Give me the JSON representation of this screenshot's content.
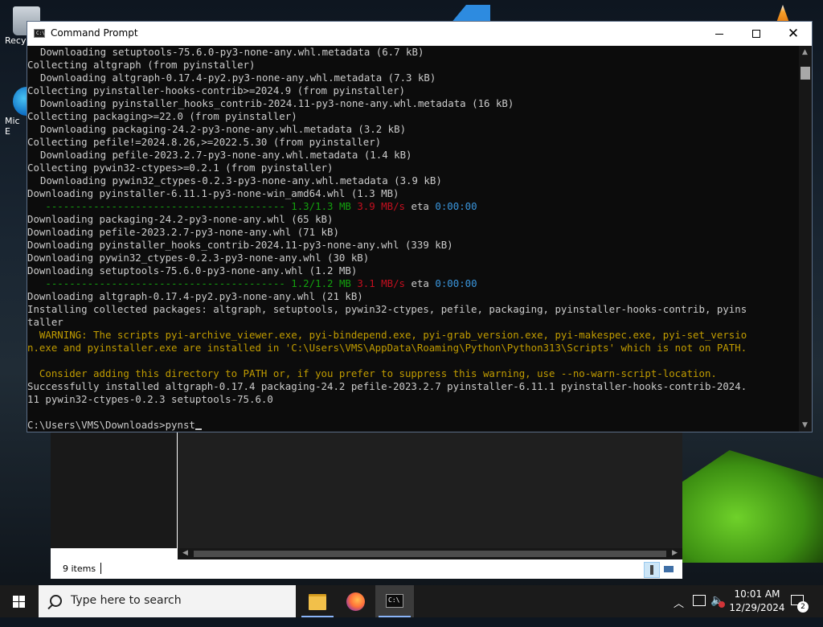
{
  "desktop": {
    "icons": [
      {
        "label": "Recy",
        "icon": "recycle-bin-icon"
      },
      {
        "label": "Mic\nE",
        "icon": "edge-icon"
      }
    ]
  },
  "cmd_window": {
    "title": "Command Prompt",
    "controls": {
      "minimize": "minimize",
      "maximize": "maximize",
      "close": "✕"
    },
    "lines": [
      {
        "type": "indent",
        "text": "Downloading setuptools-75.6.0-py3-none-any.whl.metadata (6.7 kB)"
      },
      {
        "type": "plain",
        "text": "Collecting altgraph (from pyinstaller)"
      },
      {
        "type": "indent",
        "text": "Downloading altgraph-0.17.4-py2.py3-none-any.whl.metadata (7.3 kB)"
      },
      {
        "type": "plain",
        "text": "Collecting pyinstaller-hooks-contrib>=2024.9 (from pyinstaller)"
      },
      {
        "type": "indent",
        "text": "Downloading pyinstaller_hooks_contrib-2024.11-py3-none-any.whl.metadata (16 kB)"
      },
      {
        "type": "plain",
        "text": "Collecting packaging>=22.0 (from pyinstaller)"
      },
      {
        "type": "indent",
        "text": "Downloading packaging-24.2-py3-none-any.whl.metadata (3.2 kB)"
      },
      {
        "type": "plain",
        "text": "Collecting pefile!=2024.8.26,>=2022.5.30 (from pyinstaller)"
      },
      {
        "type": "indent",
        "text": "Downloading pefile-2023.2.7-py3-none-any.whl.metadata (1.4 kB)"
      },
      {
        "type": "plain",
        "text": "Collecting pywin32-ctypes>=0.2.1 (from pyinstaller)"
      },
      {
        "type": "indent",
        "text": "Downloading pywin32_ctypes-0.2.3-py3-none-any.whl.metadata (3.9 kB)"
      },
      {
        "type": "plain",
        "text": "Downloading pyinstaller-6.11.1-py3-none-win_amd64.whl (1.3 MB)"
      },
      {
        "type": "progress",
        "bar": "----------------------------------------",
        "size": "1.3/1.3 MB",
        "speed": "3.9 MB/s",
        "eta_label": "eta",
        "eta": "0:00:00"
      },
      {
        "type": "plain",
        "text": "Downloading packaging-24.2-py3-none-any.whl (65 kB)"
      },
      {
        "type": "plain",
        "text": "Downloading pefile-2023.2.7-py3-none-any.whl (71 kB)"
      },
      {
        "type": "plain",
        "text": "Downloading pyinstaller_hooks_contrib-2024.11-py3-none-any.whl (339 kB)"
      },
      {
        "type": "plain",
        "text": "Downloading pywin32_ctypes-0.2.3-py3-none-any.whl (30 kB)"
      },
      {
        "type": "plain",
        "text": "Downloading setuptools-75.6.0-py3-none-any.whl (1.2 MB)"
      },
      {
        "type": "progress",
        "bar": "----------------------------------------",
        "size": "1.2/1.2 MB",
        "speed": "3.1 MB/s",
        "eta_label": "eta",
        "eta": "0:00:00"
      },
      {
        "type": "plain",
        "text": "Downloading altgraph-0.17.4-py2.py3-none-any.whl (21 kB)"
      },
      {
        "type": "plain",
        "text": "Installing collected packages: altgraph, setuptools, pywin32-ctypes, pefile, packaging, pyinstaller-hooks-contrib, pyins"
      },
      {
        "type": "plain",
        "text": "taller"
      },
      {
        "type": "warn",
        "text": "  WARNING: The scripts pyi-archive_viewer.exe, pyi-bindepend.exe, pyi-grab_version.exe, pyi-makespec.exe, pyi-set_versio"
      },
      {
        "type": "warn",
        "text": "n.exe and pyinstaller.exe are installed in 'C:\\Users\\VMS\\AppData\\Roaming\\Python\\Python313\\Scripts' which is not on PATH."
      },
      {
        "type": "plain",
        "text": ""
      },
      {
        "type": "warn",
        "text": "  Consider adding this directory to PATH or, if you prefer to suppress this warning, use --no-warn-script-location."
      },
      {
        "type": "plain",
        "text": "Successfully installed altgraph-0.17.4 packaging-24.2 pefile-2023.2.7 pyinstaller-6.11.1 pyinstaller-hooks-contrib-2024."
      },
      {
        "type": "plain",
        "text": "11 pywin32-ctypes-0.2.3 setuptools-75.6.0"
      },
      {
        "type": "plain",
        "text": ""
      }
    ],
    "prompt": "C:\\Users\\VMS\\Downloads>",
    "input": "pynst",
    "colors": {
      "warning": "#c19c00",
      "progress_bar": "#13a10e",
      "speed": "#c50f1f",
      "eta": "#3a96dd"
    }
  },
  "explorer": {
    "item_count": "9 items"
  },
  "taskbar": {
    "search_placeholder": "Type here to search",
    "apps": [
      "file-explorer-icon",
      "firefox-icon",
      "command-prompt-icon"
    ],
    "time": "10:01 AM",
    "date": "12/29/2024",
    "notification_count": "2"
  }
}
